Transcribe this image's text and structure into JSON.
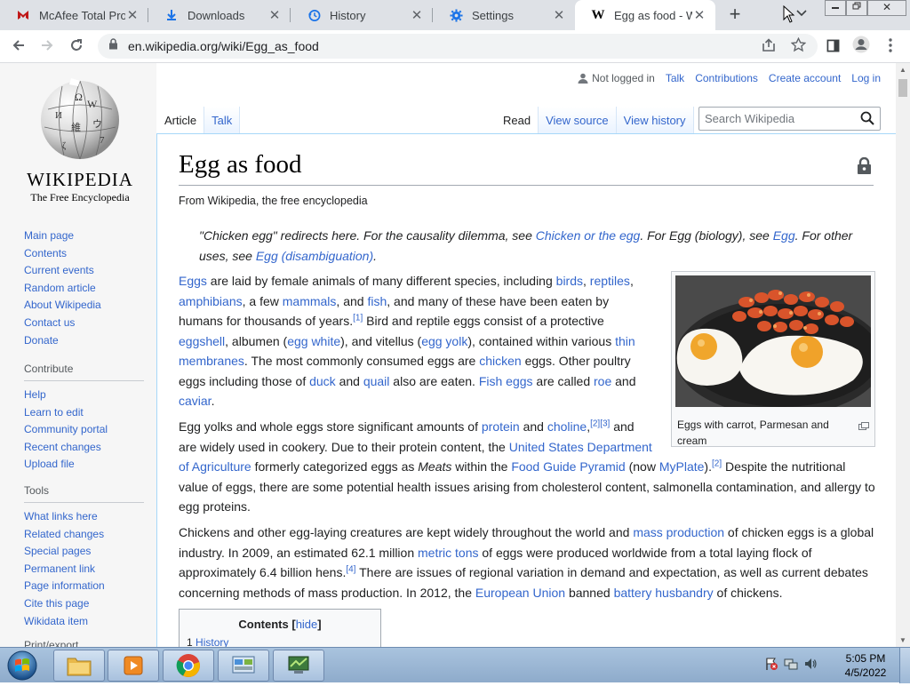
{
  "browser": {
    "tabs": [
      {
        "title": "McAfee Total Prot",
        "icon": "mcafee-icon"
      },
      {
        "title": "Downloads",
        "icon": "download-icon"
      },
      {
        "title": "History",
        "icon": "history-icon"
      },
      {
        "title": "Settings",
        "icon": "gear-icon"
      },
      {
        "title": "Egg as food - Wik",
        "icon": "wikipedia-w-icon",
        "active": true
      }
    ],
    "url": "en.wikipedia.org/wiki/Egg_as_food"
  },
  "wiki": {
    "logo": {
      "wordmark": "WIKIPEDIA",
      "tagline": "The Free Encyclopedia"
    },
    "personal": {
      "not_logged_in": "Not logged in",
      "talk": "Talk",
      "contributions": "Contributions",
      "create_account": "Create account",
      "log_in": "Log in"
    },
    "nav": {
      "main": [
        "Main page",
        "Contents",
        "Current events",
        "Random article",
        "About Wikipedia",
        "Contact us",
        "Donate"
      ],
      "contribute_heading": "Contribute",
      "contribute": [
        "Help",
        "Learn to edit",
        "Community portal",
        "Recent changes",
        "Upload file"
      ],
      "tools_heading": "Tools",
      "tools": [
        "What links here",
        "Related changes",
        "Special pages",
        "Permanent link",
        "Page information",
        "Cite this page",
        "Wikidata item"
      ],
      "print_heading": "Print/export"
    },
    "tabs": {
      "article": "Article",
      "talk": "Talk",
      "read": "Read",
      "view_source": "View source",
      "view_history": "View history"
    },
    "search_placeholder": "Search Wikipedia",
    "title": "Egg as food",
    "from": "From Wikipedia, the free encyclopedia",
    "hatnote": {
      "t1": "\"Chicken egg\" redirects here. For the causality dilemma, see ",
      "l1": "Chicken or the egg",
      "t2": ". For Egg (biology), see ",
      "l2": "Egg",
      "t3": ". For other uses, see ",
      "l3": "Egg (disambiguation)",
      "t4": "."
    },
    "infobox": {
      "caption": "Eggs with carrot, Parmesan and cream"
    },
    "p1": {
      "l_eggs": "Eggs",
      "t1": " are laid by female animals of many different species, including ",
      "l_birds": "birds",
      "c1": ", ",
      "l_reptiles": "reptiles",
      "c2": ", ",
      "l_amphibians": "amphibians",
      "t2": ", a few ",
      "l_mammals": "mammals",
      "t3": ", and ",
      "l_fish": "fish",
      "t4": ", and many of these have been eaten by humans for thousands of years.",
      "ref1": "[1]",
      "t5": " Bird and reptile eggs consist of a protective ",
      "l_eggshell": "eggshell",
      "t6": ", albumen (",
      "l_eggwhite": "egg white",
      "t7": "), and vitellus (",
      "l_eggyolk": "egg yolk",
      "t8": "), contained within various ",
      "l_membranes": "thin membranes",
      "t9": ". The most commonly consumed eggs are ",
      "l_chicken": "chicken",
      "t10": " eggs. Other poultry eggs including those of ",
      "l_duck": "duck",
      "t11": " and ",
      "l_quail": "quail",
      "t12": " also are eaten. ",
      "l_fisheggs": "Fish eggs",
      "t13": " are called ",
      "l_roe": "roe",
      "t14": " and ",
      "l_caviar": "caviar",
      "t15": "."
    },
    "p2": {
      "t1": "Egg yolks and whole eggs store significant amounts of ",
      "l_protein": "protein",
      "t2": " and ",
      "l_choline": "choline",
      "t3": ",",
      "ref23": "[2][3]",
      "t4": " and are widely used in cookery. Due to their protein content, the ",
      "l_usda": "United States Department of Agriculture",
      "t5": " formerly categorized eggs as ",
      "meats": "Meats",
      "t6": " within the ",
      "l_foodguide": "Food Guide Pyramid",
      "t7": " (now ",
      "l_myplate": "MyPlate",
      "t8": ").",
      "ref2": "[2]",
      "t9": " Despite the nutritional value of eggs, there are some potential health issues arising from cholesterol content, salmonella contamination, and allergy to egg proteins."
    },
    "p3": {
      "t1": "Chickens and other egg-laying creatures are kept widely throughout the world and ",
      "l_massprod": "mass production",
      "t2": " of chicken eggs is a global industry. In 2009, an estimated 62.1 million ",
      "l_metrictons": "metric tons",
      "t3": " of eggs were produced worldwide from a total laying flock of approximately 6.4 billion hens.",
      "ref4": "[4]",
      "t4": " There are issues of regional variation in demand and expectation, as well as current debates concerning methods of mass production. In 2012, the ",
      "l_eu": "European Union",
      "t5": " banned ",
      "l_battery": "battery husbandry",
      "t6": " of chickens."
    },
    "toc": {
      "title": "Contents",
      "hide": "hide",
      "first_num": "1",
      "first": "History"
    }
  },
  "taskbar": {
    "time": "5:05 PM",
    "date": "4/5/2022"
  }
}
